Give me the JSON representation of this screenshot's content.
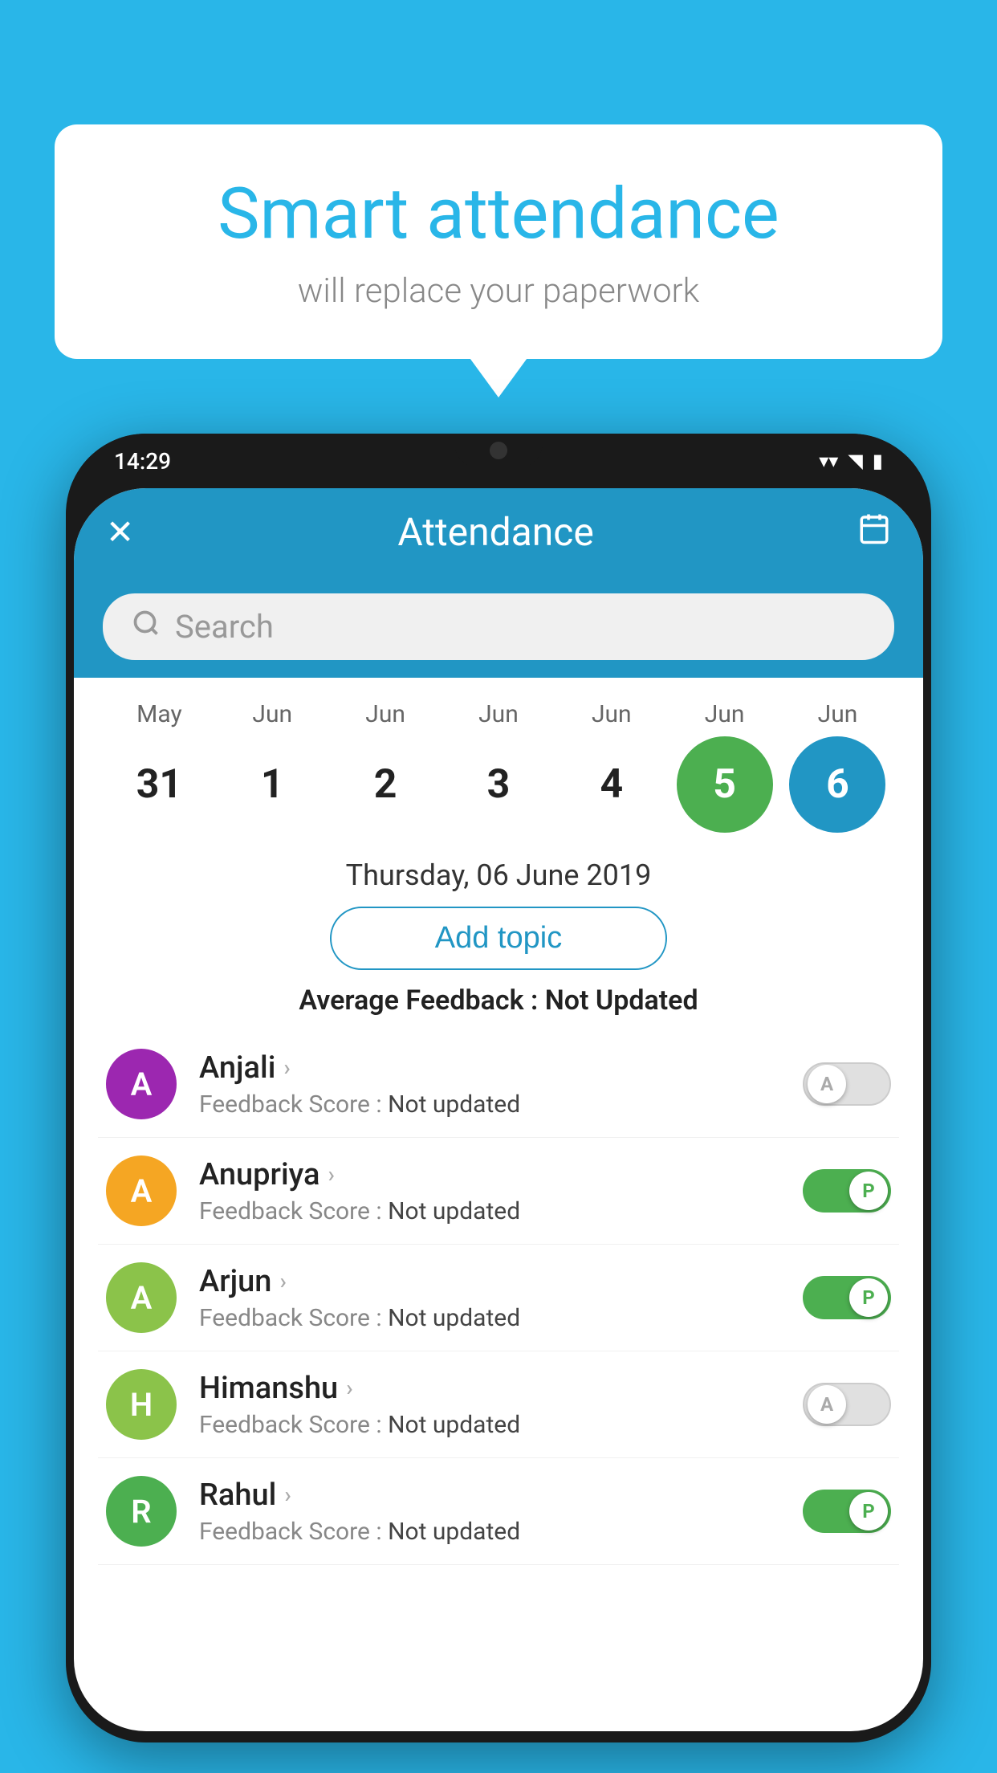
{
  "background": {
    "color": "#29b6e8"
  },
  "speech_bubble": {
    "title": "Smart attendance",
    "subtitle": "will replace your paperwork"
  },
  "phone": {
    "status_bar": {
      "time": "14:29",
      "icons": [
        "wifi",
        "signal",
        "battery"
      ]
    },
    "header": {
      "title": "Attendance",
      "close_label": "✕",
      "calendar_label": "📅"
    },
    "search": {
      "placeholder": "Search"
    },
    "calendar": {
      "months": [
        "May",
        "Jun",
        "Jun",
        "Jun",
        "Jun",
        "Jun",
        "Jun"
      ],
      "days": [
        "31",
        "1",
        "2",
        "3",
        "4",
        "5",
        "6"
      ],
      "selected_green": "5",
      "selected_blue": "6"
    },
    "selected_date": "Thursday, 06 June 2019",
    "add_topic_label": "Add topic",
    "avg_feedback_label": "Average Feedback : ",
    "avg_feedback_value": "Not Updated",
    "students": [
      {
        "name": "Anjali",
        "avatar_letter": "A",
        "avatar_color": "#9c27b0",
        "feedback_label": "Feedback Score : ",
        "feedback_value": "Not updated",
        "toggle_state": "off",
        "toggle_letter": "A"
      },
      {
        "name": "Anupriya",
        "avatar_letter": "A",
        "avatar_color": "#f5a623",
        "feedback_label": "Feedback Score : ",
        "feedback_value": "Not updated",
        "toggle_state": "on",
        "toggle_letter": "P"
      },
      {
        "name": "Arjun",
        "avatar_letter": "A",
        "avatar_color": "#8bc34a",
        "feedback_label": "Feedback Score : ",
        "feedback_value": "Not updated",
        "toggle_state": "on",
        "toggle_letter": "P"
      },
      {
        "name": "Himanshu",
        "avatar_letter": "H",
        "avatar_color": "#8bc34a",
        "feedback_label": "Feedback Score : ",
        "feedback_value": "Not updated",
        "toggle_state": "off",
        "toggle_letter": "A"
      },
      {
        "name": "Rahul",
        "avatar_letter": "R",
        "avatar_color": "#4caf50",
        "feedback_label": "Feedback Score : ",
        "feedback_value": "Not updated",
        "toggle_state": "on",
        "toggle_letter": "P"
      }
    ]
  }
}
